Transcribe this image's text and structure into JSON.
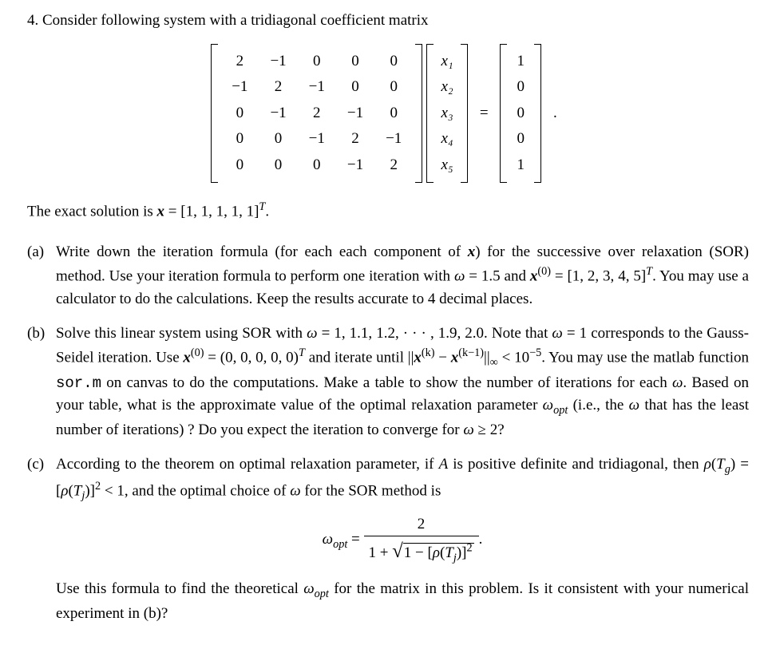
{
  "problem": {
    "number": "4.",
    "intro": "Consider following system with a tridiagonal coefficient matrix",
    "matrix_A": [
      [
        "2",
        "−1",
        "0",
        "0",
        "0"
      ],
      [
        "−1",
        "2",
        "−1",
        "0",
        "0"
      ],
      [
        "0",
        "−1",
        "2",
        "−1",
        "0"
      ],
      [
        "0",
        "0",
        "−1",
        "2",
        "−1"
      ],
      [
        "0",
        "0",
        "0",
        "−1",
        "2"
      ]
    ],
    "vector_x": [
      "x₁",
      "x₂",
      "x₃",
      "x₄",
      "x₅"
    ],
    "vector_b": [
      "1",
      "0",
      "0",
      "0",
      "1"
    ],
    "period": ".",
    "exact_pre": "The exact solution is ",
    "exact_var": "x",
    "exact_eq": " = [1, 1, 1, 1, 1]",
    "exact_sup": "T",
    "exact_post": "."
  },
  "parts": {
    "a": {
      "label": "(a)",
      "text1": "Write down the iteration formula (for each each component of ",
      "x": "x",
      "text2": ") for the successive over relaxation (SOR) method. Use your iteration formula to perform one iteration with ",
      "omega": "ω",
      "text3": " = 1.5 and ",
      "xvar": "x",
      "sup0": "(0)",
      "text4": " = [1, 2, 3, 4, 5]",
      "supT": "T",
      "text5": ". You may use a calculator to do the calculations. Keep the results accurate to 4 decimal places."
    },
    "b": {
      "label": "(b)",
      "text1": "Solve this linear system using SOR with ",
      "omega": "ω",
      "text2": " = 1, 1.1, 1.2, · · · , 1.9, 2.0. Note that ",
      "text3": " = 1 corresponds to the Gauss-Seidel iteration. Use ",
      "xvar": "x",
      "sup0": "(0)",
      "text4": " = (0, 0, 0, 0, 0)",
      "supT": "T",
      "text5": " and iterate until ||",
      "xk": "x",
      "supk": "(k)",
      "text6": " − ",
      "xkm1": "x",
      "supkm1": "(k−1)",
      "text7": "||",
      "subinf": "∞",
      "text8": " < 10",
      "supm5": "−5",
      "text9": ". You may use the matlab function ",
      "sor": "sor.m",
      "text10": " on canvas to do the computations. Make a table to show the number of iterations for each ",
      "text11": ". Based on your table, what is the approximate value of the optimal relaxation parameter ",
      "omegaopt": "ω",
      "optsub": "opt",
      "text12": " (i.e., the ",
      "text13": " that has the least number of iterations) ? Do you expect the iteration to converge for ",
      "text14": " ≥ 2?"
    },
    "c": {
      "label": "(c)",
      "text1": "According to the theorem on optimal relaxation parameter, if ",
      "A": "A",
      "text2": " is positive definite and tridiagonal, then ",
      "rho1": "ρ",
      "Tg": "T",
      "gsub": "g",
      "text3": ") = [",
      "Tj": "T",
      "jsub": "j",
      "text4": ")]",
      "sq": "2",
      "text5": " < 1, and the optimal choice of ",
      "omega": "ω",
      "text6": " for the SOR method is",
      "formula_left": "ω",
      "formula_opt": "opt",
      "formula_eq": " = ",
      "formula_num": "2",
      "formula_den_pre": "1 + ",
      "formula_den_rad_pre": "1 − [",
      "formula_rho": "ρ",
      "formula_Tj": "T",
      "formula_j": "j",
      "formula_den_rad_post": ")]",
      "formula_sq": "2",
      "formula_period": ".",
      "text7": "Use this formula to find the theoretical ",
      "text8": " for the matrix in this problem. Is it consistent with your numerical experiment in (b)?"
    }
  }
}
